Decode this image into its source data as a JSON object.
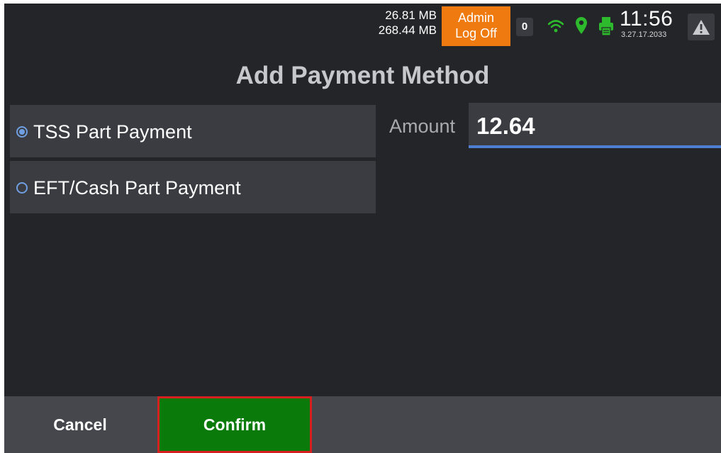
{
  "status_bar": {
    "memory_used": "26.81 MB",
    "memory_total": "268.44 MB",
    "admin_button_line1": "Admin",
    "admin_button_line2": "Log Off",
    "notification_count": "0",
    "time": "11:56",
    "version": "3.27.17.2033",
    "icons": [
      "wifi-icon",
      "location-pin-icon",
      "printer-icon",
      "warning-icon"
    ],
    "colors": {
      "admin": "#ee7a10",
      "status_green": "#2dbb2d"
    }
  },
  "page": {
    "title": "Add Payment Method"
  },
  "payment_options": [
    {
      "label": "TSS Part Payment",
      "selected": true
    },
    {
      "label": "EFT/Cash Part Payment",
      "selected": false
    }
  ],
  "amount": {
    "label": "Amount",
    "value": "12.64"
  },
  "footer": {
    "cancel_label": "Cancel",
    "confirm_label": "Confirm",
    "colors": {
      "confirm_bg": "#0a7a0a",
      "confirm_border": "#d61f1f"
    }
  }
}
